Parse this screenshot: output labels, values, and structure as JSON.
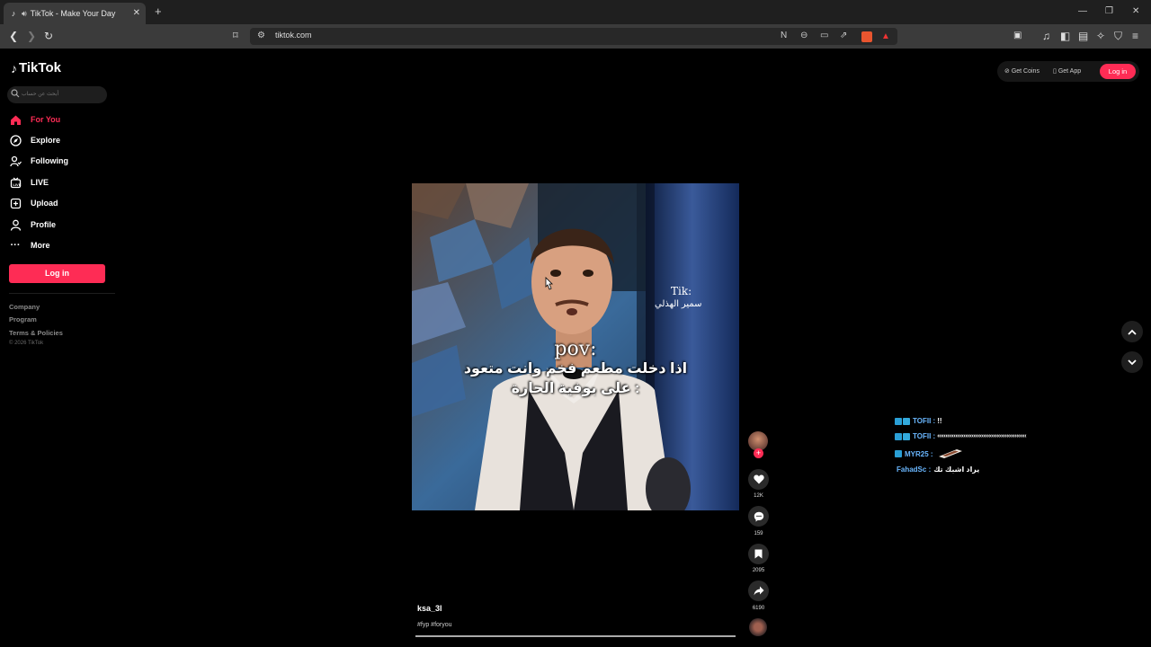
{
  "browser": {
    "tab_title": "TikTok - Make Your Day",
    "url": "tiktok.com"
  },
  "sidebar": {
    "logo": "TikTok",
    "search_placeholder": "أبحث عن حساب",
    "items": [
      {
        "label": "For You",
        "icon": "home-icon",
        "active": true
      },
      {
        "label": "Explore",
        "icon": "compass-icon"
      },
      {
        "label": "Following",
        "icon": "following-icon"
      },
      {
        "label": "LIVE",
        "icon": "live-icon"
      },
      {
        "label": "Upload",
        "icon": "upload-icon"
      },
      {
        "label": "Profile",
        "icon": "profile-icon"
      },
      {
        "label": "More",
        "icon": "more-icon"
      }
    ],
    "login": "Log in",
    "footer": [
      "Company",
      "Program",
      "Terms & Policies"
    ],
    "copyright": "© 2026 TikTok"
  },
  "topbar": {
    "get_coins": "Get Coins",
    "get_app": "Get App",
    "login": "Log in"
  },
  "video": {
    "overlay_pov": "pov:",
    "overlay_line1": "اذا دخلت مطعم فخم وانت متعود",
    "overlay_line2": "على بوفية الحارة :",
    "watermark_tik": "Tik:",
    "watermark_name": "سمير الهذلي",
    "author": "ksa_3l",
    "tags": "#fyp #foryou"
  },
  "actions": {
    "likes": "12K",
    "comments": "159",
    "saves": "2095",
    "shares": "6190"
  },
  "chat": [
    {
      "name": "TOFII :",
      "text": "!!"
    },
    {
      "name": "TOFII :",
      "text": "‹‹‹‹‹‹‹‹‹‹‹‹‹‹‹‹‹‹‹‹‹‹‹‹‹‹‹‹‹‹‹‹‹‹‹‹‹‹‹‹‹‹‹‹‹‹‹‹‹‹‹‹‹‹"
    },
    {
      "name": "MYR25 :",
      "text": ""
    },
    {
      "name": "FahadSc :",
      "text": "يراد اشبك تك"
    }
  ],
  "colors": {
    "brand": "#fe2c55",
    "background": "#000000"
  }
}
